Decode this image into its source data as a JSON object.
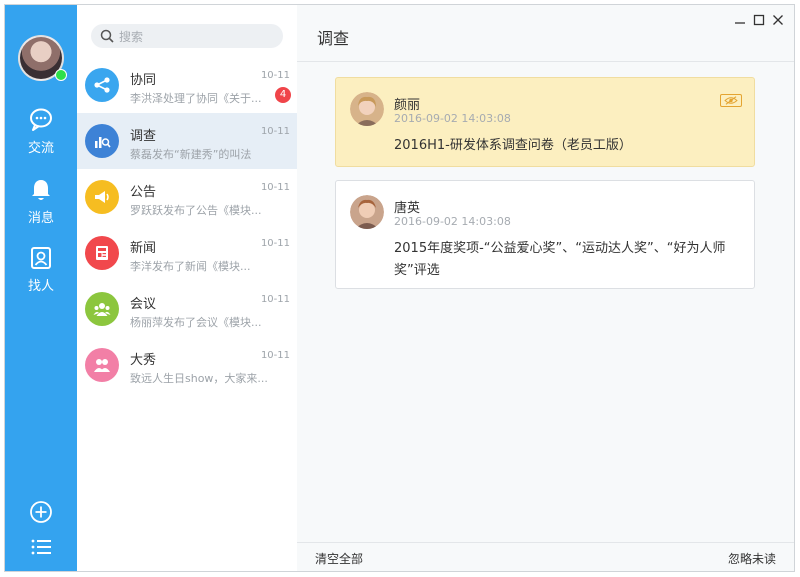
{
  "nav": {
    "items": [
      {
        "label": "交流",
        "icon": "chat-bubble-icon"
      },
      {
        "label": "消息",
        "icon": "bell-icon"
      },
      {
        "label": "找人",
        "icon": "contact-card-icon"
      }
    ],
    "bottom_icons": [
      "add-circle-icon",
      "menu-list-icon"
    ]
  },
  "search": {
    "placeholder": "搜索"
  },
  "conversations": [
    {
      "name": "协同",
      "date": "10-11",
      "preview": "李洪泽处理了协同《关于...",
      "badge": "4",
      "color": "#3aa6ef",
      "icon": "share-nodes-icon"
    },
    {
      "name": "调查",
      "date": "10-11",
      "preview": "蔡磊发布“新建秀”的叫法",
      "color": "#3d82d6",
      "icon": "survey-chart-icon"
    },
    {
      "name": "公告",
      "date": "10-11",
      "preview": "罗跃跃发布了公告《模块...",
      "color": "#f6bd21",
      "icon": "megaphone-icon"
    },
    {
      "name": "新闻",
      "date": "10-11",
      "preview": "李洋发布了新闻《模块...",
      "color": "#f1484c",
      "icon": "newspaper-icon"
    },
    {
      "name": "会议",
      "date": "10-11",
      "preview": "杨丽萍发布了会议《模块...",
      "color": "#8cc63e",
      "icon": "people-group-icon"
    },
    {
      "name": "大秀",
      "date": "10-11",
      "preview": "致远人生日show，大家来...",
      "color": "#f27fa6",
      "icon": "people-pair-icon"
    }
  ],
  "main": {
    "title": "调查",
    "cards": [
      {
        "person": "颜丽",
        "time": "2016-09-02 14:03:08",
        "content": "2016H1-研发体系调查问卷（老员工版）"
      },
      {
        "person": "唐英",
        "time": "2016-09-02 14:03:08",
        "content": "2015年度奖项-“公益爱心奖”、“运动达人奖”、“好为人师奖”评选"
      }
    ],
    "footer": {
      "clear_all": "清空全部",
      "ignore_unread": "忽略未读"
    }
  },
  "colors": {
    "nav_bg": "#34a3ef",
    "highlight_card": "#fcefc0",
    "badge": "#f0454a",
    "online": "#2ee04a"
  }
}
